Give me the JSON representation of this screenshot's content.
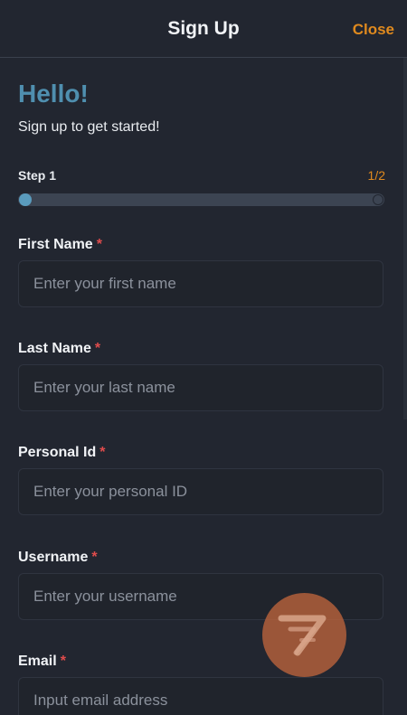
{
  "header": {
    "title": "Sign Up",
    "close_label": "Close"
  },
  "intro": {
    "greeting": "Hello!",
    "subtitle": "Sign up to get started!"
  },
  "progress": {
    "step_label": "Step 1",
    "step_count": "1/2",
    "fraction": 0.0
  },
  "form": {
    "required_mark": "*",
    "fields": [
      {
        "label": "First Name",
        "placeholder": "Enter your first name",
        "value": ""
      },
      {
        "label": "Last Name",
        "placeholder": "Enter your last name",
        "value": ""
      },
      {
        "label": "Personal Id",
        "placeholder": "Enter your personal ID",
        "value": ""
      },
      {
        "label": "Username",
        "placeholder": "Enter your username",
        "value": ""
      },
      {
        "label": "Email",
        "placeholder": "Input email address",
        "value": ""
      }
    ]
  },
  "floating_button": {
    "icon": "arrow-logo-icon"
  },
  "colors": {
    "background": "#222630",
    "accent_orange": "#e08a1e",
    "accent_blue": "#4f8faf",
    "required_red": "#e04c4c"
  }
}
